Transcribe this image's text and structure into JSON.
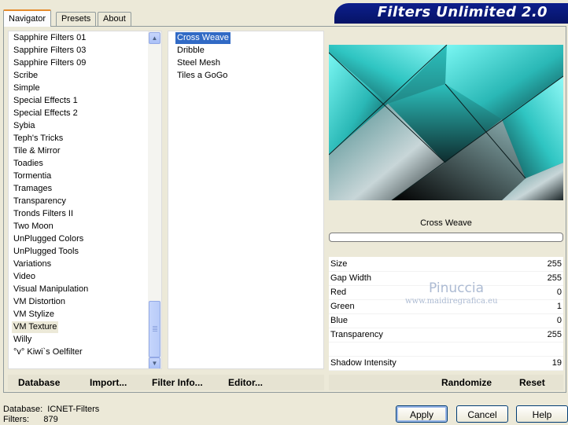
{
  "tabs": [
    "Navigator",
    "Presets",
    "About"
  ],
  "app_title": "Filters Unlimited 2.0",
  "categories": [
    "Sapphire Filters 01",
    "Sapphire Filters 03",
    "Sapphire Filters 09",
    "Scribe",
    "Simple",
    "Special Effects 1",
    "Special Effects 2",
    "Sybia",
    "Teph's Tricks",
    "Tile & Mirror",
    "Toadies",
    "Tormentia",
    "Tramages",
    "Transparency",
    "Tronds Filters II",
    "Two Moon",
    "UnPlugged Colors",
    "UnPlugged Tools",
    "Variations",
    "Video",
    "Visual Manipulation",
    "VM Distortion",
    "VM Stylize",
    "VM Texture",
    "Willy",
    "°v° Kiwi`s Oelfilter"
  ],
  "selected_category": "VM Texture",
  "filters": [
    "Cross Weave",
    "Dribble",
    "Steel Mesh",
    "Tiles a GoGo"
  ],
  "selected_filter": "Cross Weave",
  "preview_label": "Cross Weave",
  "params": [
    {
      "name": "Size",
      "value": "255"
    },
    {
      "name": "Gap Width",
      "value": "255"
    },
    {
      "name": "Red",
      "value": "0"
    },
    {
      "name": "Green",
      "value": "1"
    },
    {
      "name": "Blue",
      "value": "0"
    },
    {
      "name": "Transparency",
      "value": "255"
    },
    {
      "name": "",
      "value": ""
    },
    {
      "name": "Shadow Intensity",
      "value": "19"
    }
  ],
  "watermark": {
    "name": "Pinuccia",
    "url": "www.maidiregrafica.eu"
  },
  "links_left": [
    "Database",
    "Import...",
    "Filter Info...",
    "Editor..."
  ],
  "links_right": [
    "Randomize",
    "Reset"
  ],
  "status": {
    "database_label": "Database:",
    "database_value": "ICNET-Filters",
    "filters_label": "Filters:",
    "filters_value": "879"
  },
  "buttons": {
    "apply": "Apply",
    "cancel": "Cancel",
    "help": "Help"
  },
  "colors": {
    "accent_tab": "#e68b2c",
    "selection": "#316ac5",
    "banner": "#0d1f8c",
    "preview_teal": "#3fd6d6"
  }
}
